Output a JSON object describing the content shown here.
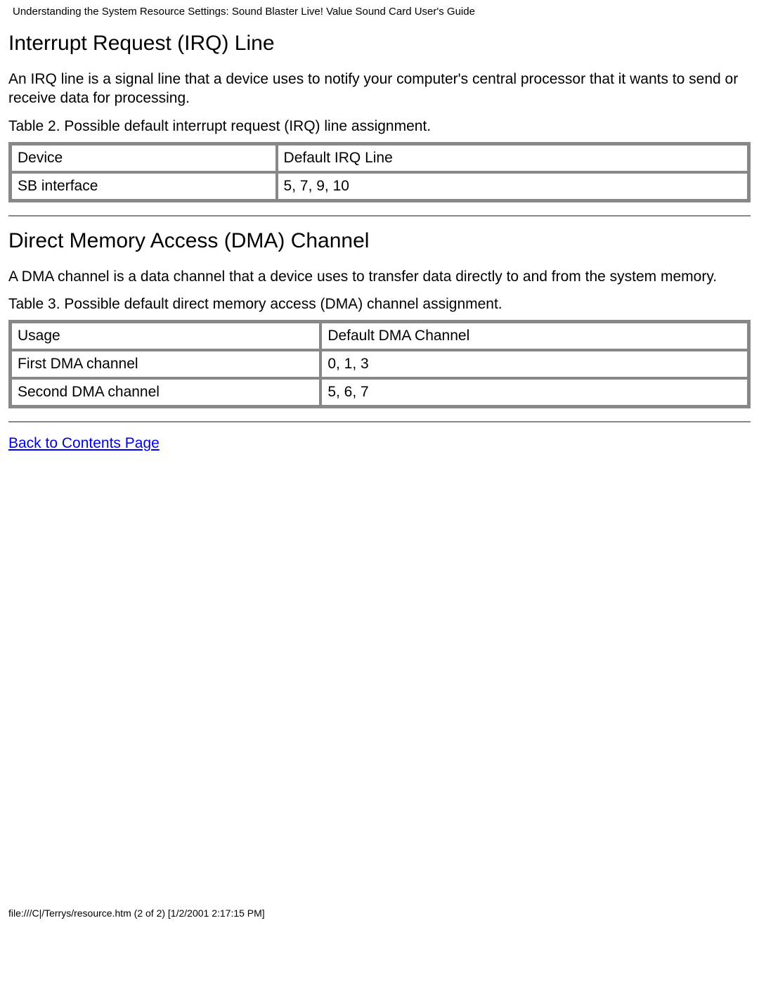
{
  "header": {
    "title": "Understanding the System Resource Settings: Sound Blaster Live! Value Sound Card User's Guide"
  },
  "section_irq": {
    "heading": "Interrupt Request (IRQ) Line",
    "paragraph": "An IRQ line is a signal line that a device uses to notify your computer's central processor that it wants to send or receive data for processing.",
    "table_caption": "Table 2. Possible default interrupt request (IRQ) line assignment.",
    "col1_header": "Device",
    "col2_header": "Default IRQ Line",
    "row1_col1": "SB interface",
    "row1_col2": "5, 7, 9, 10"
  },
  "section_dma": {
    "heading": "Direct Memory Access (DMA) Channel",
    "paragraph": "A DMA channel is a data channel that a device uses to transfer data directly to and from the system memory.",
    "table_caption": "Table 3. Possible default direct memory access (DMA) channel assignment.",
    "col1_header": "Usage",
    "col2_header": "Default DMA Channel",
    "row1_col1": "First DMA channel",
    "row1_col2": "0, 1, 3",
    "row2_col1": "Second DMA channel",
    "row2_col2": "5, 6, 7"
  },
  "link": {
    "back_label": "Back to Contents Page"
  },
  "footer": {
    "text": "file:///C|/Terrys/resource.htm (2 of 2) [1/2/2001 2:17:15 PM]"
  }
}
